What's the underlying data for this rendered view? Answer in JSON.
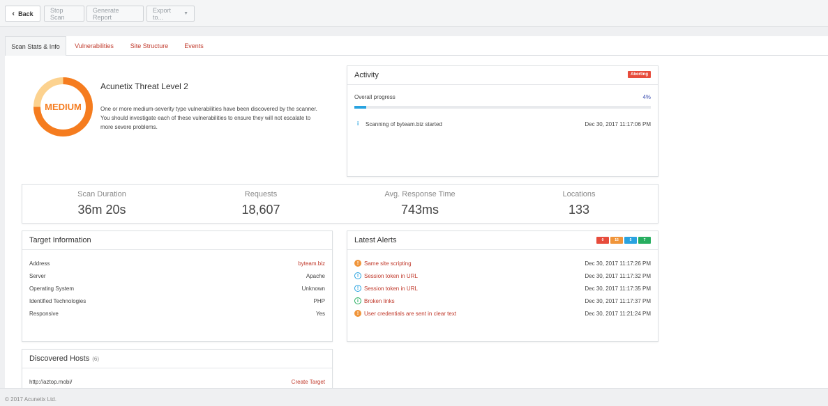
{
  "toolbar": {
    "back_label": "Back",
    "stop_label": "Stop Scan",
    "report_label": "Generate Report",
    "export_label": "Export to..."
  },
  "tabs": [
    {
      "label": "Scan Stats & Info",
      "active": true
    },
    {
      "label": "Vulnerabilities",
      "active": false
    },
    {
      "label": "Site Structure",
      "active": false
    },
    {
      "label": "Events",
      "active": false
    }
  ],
  "threat": {
    "level_badge": "MEDIUM",
    "title": "Acunetix Threat Level 2",
    "description": "One or more medium-severity type vulnerabilities have been discovered by the scanner. You should investigate each of these vulnerabilities to ensure they will not escalate to more severe problems.",
    "colors": {
      "ring": "#f57c1f",
      "ring_light": "#fcd28f",
      "text": "#f57c1f"
    }
  },
  "activity": {
    "title": "Activity",
    "status": "Aborting",
    "progress_label": "Overall progress",
    "progress_text": "4%",
    "progress": 4,
    "events": [
      {
        "icon": "info-icon",
        "text": "Scanning of byteam.biz started",
        "time": "Dec 30, 2017 11:17:06 PM"
      }
    ]
  },
  "stats": [
    {
      "label": "Scan Duration",
      "value": "36m 20s"
    },
    {
      "label": "Requests",
      "value": "18,607"
    },
    {
      "label": "Avg. Response Time",
      "value": "743ms"
    },
    {
      "label": "Locations",
      "value": "133"
    }
  ],
  "target_info": {
    "title": "Target Information",
    "rows": [
      {
        "key": "Address",
        "value": "byteam.biz"
      },
      {
        "key": "Server",
        "value": "Apache"
      },
      {
        "key": "Operating System",
        "value": "Unknown"
      },
      {
        "key": "Identified Technologies",
        "value": "PHP"
      },
      {
        "key": "Responsive",
        "value": "Yes"
      }
    ]
  },
  "latest_alerts": {
    "title": "Latest Alerts",
    "badges": [
      {
        "value": "0",
        "color": "#e74c3c"
      },
      {
        "value": "15",
        "color": "#f0953a"
      },
      {
        "value": "5",
        "color": "#29a3e0"
      },
      {
        "value": "7",
        "color": "#27ae60"
      }
    ],
    "rows": [
      {
        "severity": "medium",
        "name": "Same site scripting",
        "time": "Dec 30, 2017 11:17:26 PM"
      },
      {
        "severity": "low",
        "name": "Session token in URL",
        "time": "Dec 30, 2017 11:17:32 PM"
      },
      {
        "severity": "low",
        "name": "Session token in URL",
        "time": "Dec 30, 2017 11:17:35 PM"
      },
      {
        "severity": "info",
        "name": "Broken links",
        "time": "Dec 30, 2017 11:17:37 PM"
      },
      {
        "severity": "medium",
        "name": "User credentials are sent in clear text",
        "time": "Dec 30, 2017 11:21:24 PM"
      }
    ]
  },
  "hosts": {
    "title": "Discovered Hosts",
    "count": "(6)",
    "first_url": "http://aztop.mobi/",
    "create_label": "Create Target"
  },
  "footer": {
    "copyright": "© 2017 Acunetix Ltd."
  }
}
